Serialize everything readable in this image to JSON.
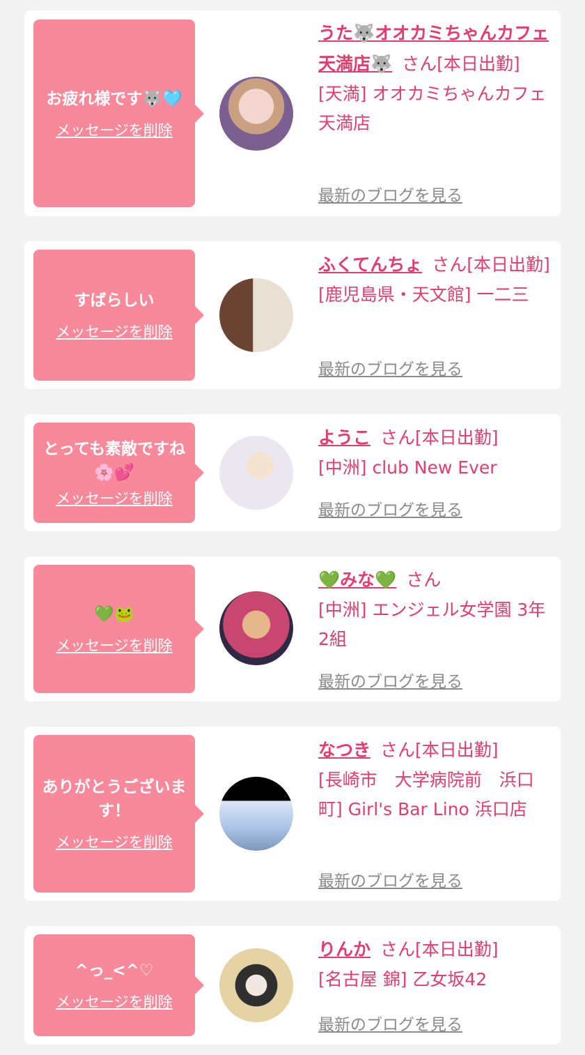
{
  "messages": [
    {
      "bubble": "お疲れ様です🐺🩵",
      "delete": "メッセージを削除",
      "name": "うた🐺オオカミちゃんカフェ天満店🐺",
      "suffix": "さん[本日出勤]",
      "shop": "[天満] オオカミちゃんカフェ天満店",
      "blog": "最新のブログを見る",
      "avatar_colors": [
        "#d99aa8",
        "#6b4f86"
      ]
    },
    {
      "bubble": "すばらしい",
      "delete": "メッセージを削除",
      "name": "ふくてんちょ",
      "suffix": "さん[本日出勤]",
      "shop": "[鹿児島県・天文館] 一二三",
      "blog": "最新のブログを見る",
      "avatar_colors": [
        "#9b6a4a",
        "#e7dccb"
      ]
    },
    {
      "bubble": "とっても素敵ですね🌸💕",
      "delete": "メッセージを削除",
      "name": "ようこ",
      "suffix": "さん[本日出勤]",
      "shop": "[中洲] club New Ever",
      "blog": "最新のブログを見る",
      "avatar_colors": [
        "#e8e6ef",
        "#c9c4d6"
      ]
    },
    {
      "bubble": "💚🐸",
      "delete": "メッセージを削除",
      "name": "💚みな💚",
      "suffix": "さん",
      "shop": "[中洲] エンジェル女学園 3年2組",
      "blog": "最新のブログを見る",
      "avatar_colors": [
        "#c8466f",
        "#3a2f4f"
      ]
    },
    {
      "bubble": "ありがとうございます！",
      "delete": "メッセージを削除",
      "name": "なつき",
      "suffix": "さん[本日出勤]",
      "shop": "[長崎市　大学病院前　浜口町] Girl's Bar Lino 浜口店",
      "blog": "最新のブログを見る",
      "avatar_colors": [
        "#000000",
        "#a9c3e6"
      ]
    },
    {
      "bubble": "^っ_<^♡",
      "delete": "メッセージを削除",
      "name": "りんか",
      "suffix": "さん[本日出勤]",
      "shop": "[名古屋 錦] 乙女坂42",
      "blog": "最新のブログを見る",
      "avatar_colors": [
        "#e5d3a3",
        "#3b3b3b"
      ]
    }
  ]
}
